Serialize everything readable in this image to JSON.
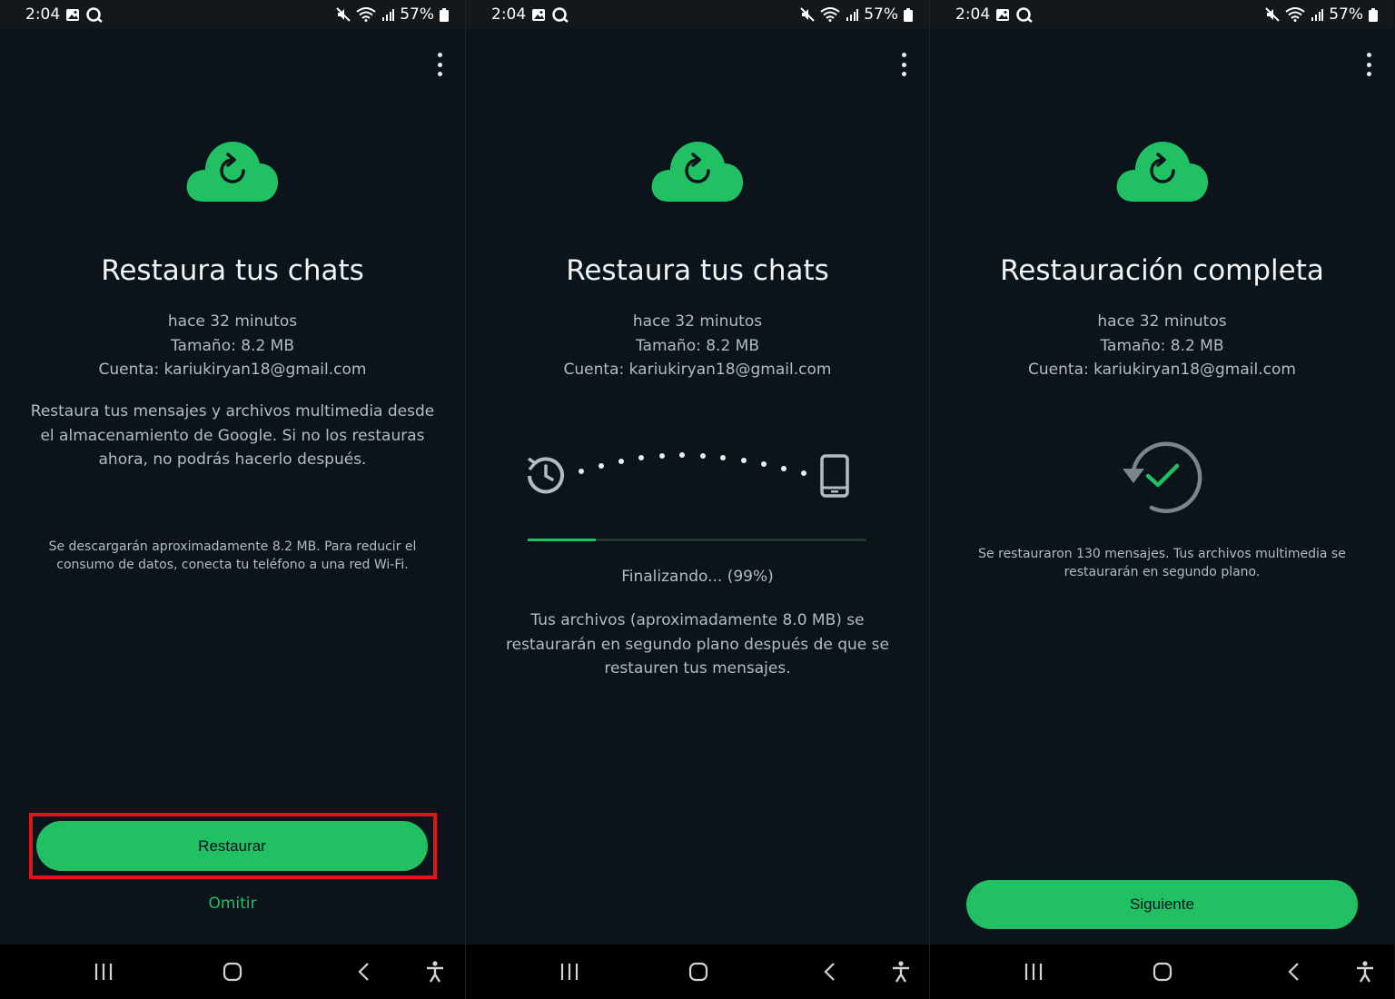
{
  "colors": {
    "accent": "#21c063",
    "background": "#0b141a",
    "highlight_frame": "#e3131b"
  },
  "status_bar": {
    "time": "2:04",
    "battery": "57%",
    "icons": [
      "gallery-icon",
      "loop-icon",
      "mute-icon",
      "wifi-icon",
      "signal-icon",
      "battery-icon"
    ]
  },
  "screens": [
    {
      "title": "Restaura tus chats",
      "meta": {
        "time_ago": "hace 32 minutos",
        "size": "Tamaño: 8.2 MB",
        "account": "Cuenta: kariukiryan18@gmail.com"
      },
      "description": "Restaura tus mensajes y archivos multimedia desde el almacenamiento de Google. Si no los restauras ahora, no podrás hacerlo después.",
      "note": "Se descargarán aproximadamente 8.2 MB. Para reducir el consumo de datos, conecta tu teléfono a una red Wi-Fi.",
      "primary_button": "Restaurar",
      "secondary_link": "Omitir"
    },
    {
      "title": "Restaura tus chats",
      "meta": {
        "time_ago": "hace 32 minutos",
        "size": "Tamaño: 8.2 MB",
        "account": "Cuenta: kariukiryan18@gmail.com"
      },
      "progress_fraction": 0.2,
      "progress_label": "Finalizando... (99%)",
      "description": "Tus archivos (aproximadamente 8.0 MB) se restaurarán en segundo plano después de que se restauren tus mensajes."
    },
    {
      "title": "Restauración completa",
      "meta": {
        "time_ago": "hace 32 minutos",
        "size": "Tamaño: 8.2 MB",
        "account": "Cuenta: kariukiryan18@gmail.com"
      },
      "note": "Se restauraron 130 mensajes. Tus archivos multimedia se restaurarán en segundo plano.",
      "primary_button": "Siguiente"
    }
  ],
  "nav_bar": {
    "items": [
      "recents-icon",
      "home-icon",
      "back-icon",
      "accessibility-icon"
    ]
  }
}
